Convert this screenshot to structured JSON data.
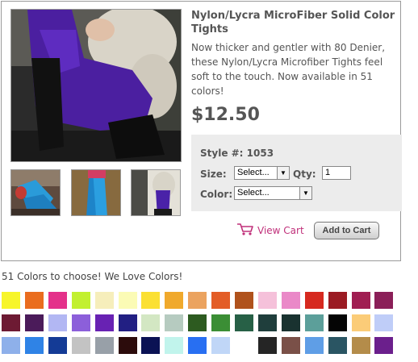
{
  "product": {
    "title": "Nylon/Lycra MicroFiber Solid Color Tights",
    "description": "Now thicker and gentler with 80 Denier, these Nylon/Lycra Microfiber Tights feel soft to the touch. Now available in 51 colors!",
    "price": "$12.50"
  },
  "options": {
    "style_label": "Style #: 1053",
    "size_label": "Size:",
    "size_selected": "Select...",
    "qty_label": "Qty:",
    "qty_value": "1",
    "color_label": "Color:",
    "color_selected": "Select..."
  },
  "actions": {
    "view_cart": "View Cart",
    "add_to_cart": "Add to Cart"
  },
  "colors_heading": "51 Colors to choose! We Love Colors!",
  "swatches": [
    [
      "#f7f52a",
      "#ea6d1e",
      "#e4318a",
      "#c2f030",
      "#f6eebb",
      "#fbfbb5",
      "#fbe033",
      "#f0a92c",
      "#eba35f",
      "#e35d27",
      "#b0521c",
      "#f5c1da",
      "#ea89c8",
      "#d6291f",
      "#9b1b23",
      "#a01e52",
      "#8b1f58"
    ],
    [
      "#6d1a33",
      "#4b1b5a",
      "#b2b7f3",
      "#8c5fda",
      "#6822b3",
      "#221f83",
      "#d3e7c3",
      "#b6cbc0",
      "#2d5b20",
      "#3b8e35",
      "#276046",
      "#1f3e3c",
      "#193230",
      "#5c9f9a",
      "#050505",
      "#fbcc78",
      "#bfcdf8"
    ],
    [
      "#8eb0ea",
      "#2f83e6",
      "#143b96",
      "#c3c3c3",
      "#98a0a8",
      "#2c0c0c",
      "#0b1254",
      "#c1f4ec",
      "#286ff2",
      "#c0d6f7",
      "#ffffff",
      "#252525",
      "#7a5048",
      "#5f9ee6",
      "#2a5563",
      "#b48c4a",
      "#6b1f8c"
    ]
  ]
}
